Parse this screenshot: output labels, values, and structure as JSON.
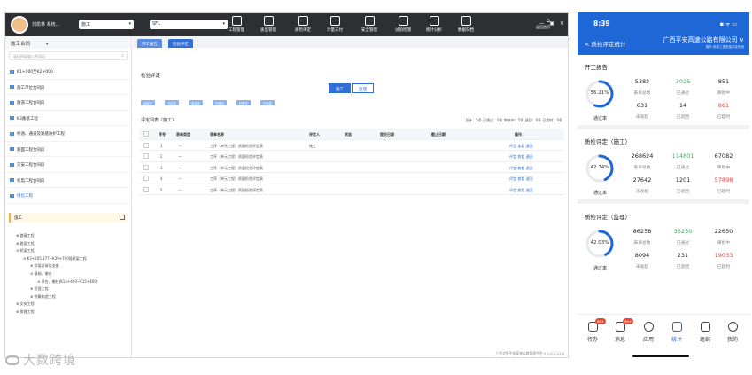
{
  "desktop": {
    "topbar": {
      "user": "刘凯林  系统...",
      "project_select": "施工",
      "unit_select": "SF1",
      "modules": [
        "工程管理",
        "质监管理",
        "质检评定",
        "计量支付",
        "安全管理",
        "试验检测",
        "统计分析",
        "数据归档"
      ],
      "right_label": "返回首页",
      "window_controls": "— ▣ ✕"
    },
    "sidebar": {
      "header": "施工合同",
      "search_placeholder": "请选择或输入合同段",
      "items": [
        "K1+000至K2+000",
        "施工单位合同段",
        "隧道工程合同段",
        "K3路基工程",
        "桥涵、通道及路基防护工程",
        "路面工程合同段",
        "交安工程合同段",
        "机电工程合同段",
        "房建工程",
        "绿化工程"
      ],
      "panel_title": "施工",
      "tree": [
        "⊕ 路基工程",
        "⊕ 路面工程",
        "⊖ 桥梁工程",
        "⊖ K3+205.877~K39+700段桥梁工程",
        "⊕ 桥梁总体及支座",
        "⊖ 基础、墩台",
        "⊖ 承台、墩柱(K14+400~K15+400)",
        "⊕ 桥面工程",
        "⊕ 附属构造工程",
        "⊕ 交安工程",
        "⊕ 房建工程"
      ]
    },
    "main": {
      "tabs": [
        "开工报告",
        "检验评定"
      ],
      "page_title": "检验评定",
      "segments": [
        "施工",
        "监理"
      ],
      "filter_buttons": [
        "待评定",
        "已评定",
        "未评定",
        "已退回",
        "已签字",
        "已完成"
      ],
      "grid_title": "评定列表（施工）",
      "stats": "总计：5条   已通过：0条   审核中：5条   退回：0条   已超时：0条",
      "columns": [
        "",
        "序号",
        "表单类型",
        "表单名称",
        "评定人",
        "状态",
        "提交日期",
        "截止日期",
        "操作"
      ],
      "rows": [
        {
          "no": "1",
          "type": "—",
          "name": "工序（单元工程）质量检验评定表",
          "user": "施工",
          "status": "",
          "date": "",
          "deadline": "",
          "ops": "评定 查看 退回"
        },
        {
          "no": "2",
          "type": "—",
          "name": "工序（单元工程）质量检验评定表",
          "user": "",
          "status": "",
          "date": "",
          "deadline": "",
          "ops": "评定 查看 退回"
        },
        {
          "no": "3",
          "type": "—",
          "name": "工序（单元工程）质量检验评定表",
          "user": "",
          "status": "",
          "date": "",
          "deadline": "",
          "ops": "评定 查看 退回"
        },
        {
          "no": "4",
          "type": "—",
          "name": "工序（单元工程）质量检验评定表",
          "user": "",
          "status": "",
          "date": "",
          "deadline": "",
          "ops": "评定 查看 退回"
        },
        {
          "no": "5",
          "type": "—",
          "name": "工序（单元工程）质量检验评定表",
          "user": "",
          "status": "",
          "date": "",
          "deadline": "",
          "ops": "评定 查看 退回"
        }
      ],
      "footer": "广西交投平安高速公路管理平台 V 1.0.2.12.0"
    }
  },
  "phone": {
    "time": "8:39",
    "system_icons": "◾ ᯤ ▭",
    "back": "< 质检评定统计",
    "company": "广西平安高速公路有限公司 ∨",
    "company_sub": "格外-桥梁工程质量评定系统",
    "rate_label": "通过率",
    "captions": [
      "表单总数",
      "已通过",
      "审批中",
      "未发起",
      "已退回",
      "已超时"
    ],
    "sections": [
      {
        "title": "开工报告",
        "rate": "56.21%",
        "rate_value": 56.21,
        "values": [
          "5382",
          "3025",
          "851",
          "631",
          "14",
          "861"
        ]
      },
      {
        "title": "质检评定（施工）",
        "rate": "42.74%",
        "rate_value": 42.74,
        "values": [
          "268624",
          "114801",
          "67082",
          "27642",
          "1201",
          "57898"
        ]
      },
      {
        "title": "质检评定（监理）",
        "rate": "42.03%",
        "rate_value": 42.03,
        "values": [
          "86258",
          "36250",
          "22650",
          "8094",
          "231",
          "19033"
        ]
      }
    ],
    "nav": [
      {
        "label": "待办",
        "badge": "99+"
      },
      {
        "label": "消息",
        "badge": "99+"
      },
      {
        "label": "应用",
        "badge": ""
      },
      {
        "label": "统计",
        "badge": ""
      },
      {
        "label": "组织",
        "badge": ""
      },
      {
        "label": "我的",
        "badge": ""
      }
    ],
    "colors": {
      "primary": "#1f66d6",
      "green": "#3cae62",
      "red": "#e0423c"
    }
  },
  "watermark": "大数跨境"
}
